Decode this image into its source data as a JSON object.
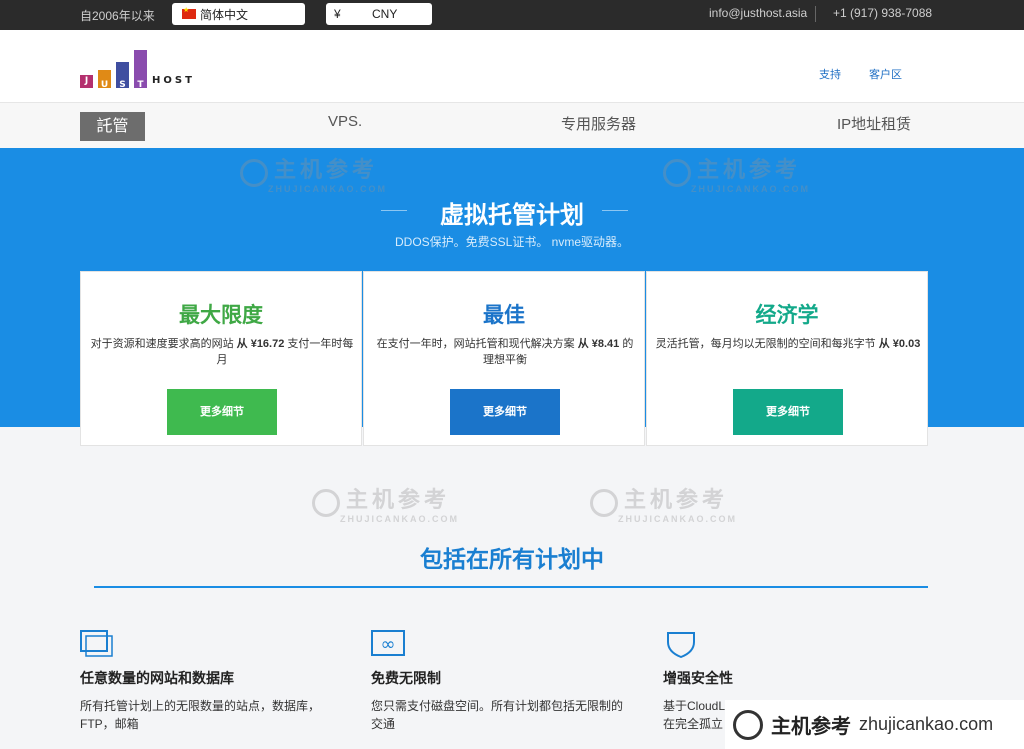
{
  "topbar": {
    "since": "自2006年以来",
    "language": "简体中文",
    "currency_symbol": "¥",
    "currency": "CNY",
    "email": "info@justhost.asia",
    "phone": "+1 (917) 938-7088"
  },
  "header": {
    "logo_letters": [
      "J",
      "U",
      "S",
      "T"
    ],
    "logo_host": "HOST",
    "support": "支持",
    "client_area": "客户区"
  },
  "nav": {
    "items": [
      "託管",
      "VPS.",
      "专用服务器",
      "IP地址租赁"
    ]
  },
  "hero": {
    "title": "虚拟托管计划",
    "subtitle": "DDOS保护。免费SSL证书。 nvme驱动器。"
  },
  "plans": [
    {
      "title": "最大限度",
      "desc_pre": "对于资源和速度要求高的网站",
      "desc_bold": "从 ¥16.72",
      "desc_post": "支付一年时每月",
      "button": "更多细节",
      "color": "#3fba4f"
    },
    {
      "title": "最佳",
      "desc_pre": "在支付一年时，网站托管和现代解决方案",
      "desc_bold": "从 ¥8.41",
      "desc_post": "的理想平衡",
      "button": "更多细节",
      "color": "#1b74c9"
    },
    {
      "title": "经济学",
      "desc_pre": "灵活托管，每月均以无限制的空间和每兆字节",
      "desc_bold": "从 ¥0.03",
      "desc_post": "",
      "button": "更多细节",
      "color": "#13a98a"
    }
  ],
  "section": {
    "title": "包括在所有计划中"
  },
  "features": [
    {
      "title": "任意数量的网站和数据库",
      "desc": "所有托管计划上的无限数量的站点，数据库，FTP，邮箱"
    },
    {
      "title": "免费无限制",
      "desc": "您只需支付磁盘空间。所有计划都包括无限制的交通"
    },
    {
      "title": "增强安全性",
      "desc": "基于CloudL 在完全孤立"
    }
  ],
  "watermark": {
    "cn": "主机参考",
    "en": "ZHUJICANKAO.COM",
    "badge_cn": "主机参考",
    "badge_url": "zhujicankao.com"
  }
}
